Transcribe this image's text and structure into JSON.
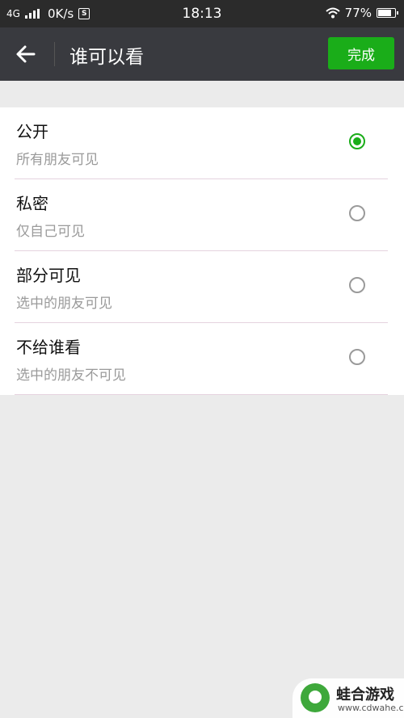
{
  "status_bar": {
    "network": "4G",
    "speed": "0K/s",
    "s_badge": "S",
    "time": "18:13",
    "battery_text": "77%",
    "battery_level": 0.77
  },
  "header": {
    "back_icon": "arrow-left-icon",
    "title": "谁可以看",
    "done_label": "完成",
    "accent_color": "#1aad19"
  },
  "options": [
    {
      "label": "公开",
      "sub": "所有朋友可见",
      "selected": true
    },
    {
      "label": "私密",
      "sub": "仅自己可见",
      "selected": false
    },
    {
      "label": "部分可见",
      "sub": "选中的朋友可见",
      "selected": false
    },
    {
      "label": "不给谁看",
      "sub": "选中的朋友不可见",
      "selected": false
    }
  ],
  "watermark": {
    "name": "蛙合游戏",
    "url": "www.cdwahe.com"
  }
}
